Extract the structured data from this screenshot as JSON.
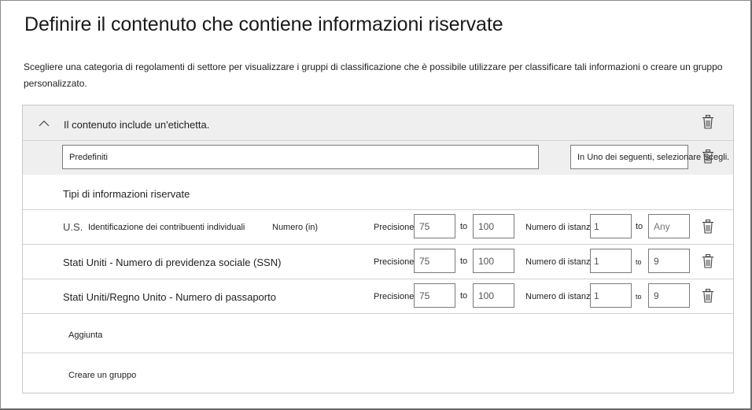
{
  "page": {
    "title": "Definire il contenuto che contiene informazioni riservate",
    "description": "Scegliere una categoria di regolamenti di settore per visualizzare i gruppi di classificazione che è possibile utilizzare per classificare tali informazioni o creare un gruppo personalizzato."
  },
  "header": {
    "label": "Il contenuto include un'etichetta.",
    "group_name_value": "Predefiniti",
    "operator_value": "In Uno dei seguenti, selezionare Scegli."
  },
  "section": {
    "title": "Tipi di informazioni riservate"
  },
  "rows": [
    {
      "prefix": "U.S.",
      "name": "Identificazione dei contribuenti individuali",
      "suffix": "Numero (in)",
      "precision_label": "Precisione",
      "min_precision": "75",
      "to1": "to",
      "max_precision": "100",
      "instances_label": "Numero di istanze",
      "min_instances": "1",
      "to2": "to",
      "max_instances": "Any"
    },
    {
      "name": "Stati Uniti - Numero di previdenza sociale (SSN)",
      "precision_label": "Precisione",
      "min_precision": "75",
      "to1": "to",
      "max_precision": "100",
      "instances_label": "Numero di istanze",
      "min_instances": "1",
      "to2": "to",
      "max_instances": "9"
    },
    {
      "name": "Stati Uniti/Regno Unito - Numero di passaporto",
      "precision_label": "Precisione",
      "min_precision": "75",
      "to1": "to",
      "max_precision": "100",
      "instances_label": "Numero di istanze",
      "min_instances": "1",
      "to2": "to",
      "max_instances": "9"
    }
  ],
  "actions": {
    "add_label": "Aggiunta",
    "create_group_label": "Creare un gruppo"
  },
  "icons": {
    "collapse": "chevron-up-icon",
    "delete": "trash-icon"
  }
}
